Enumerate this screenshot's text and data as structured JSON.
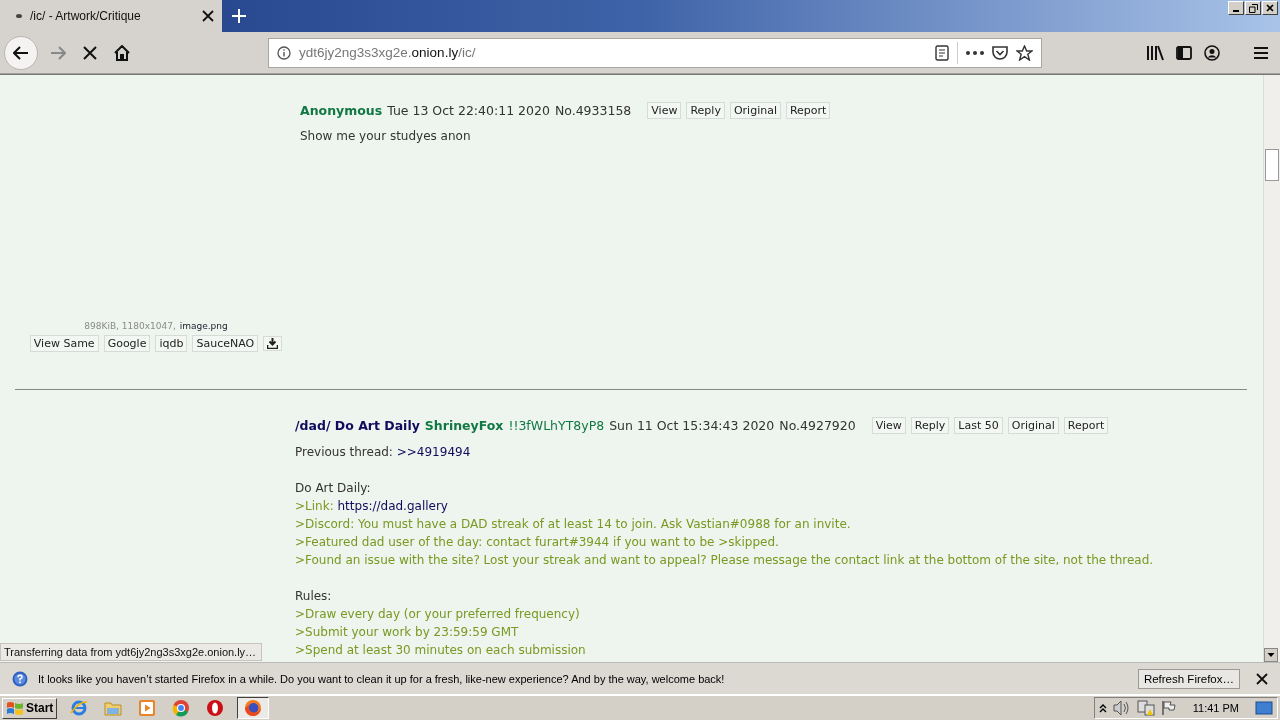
{
  "browser": {
    "tab": {
      "title": "/ic/ - Artwork/Critique",
      "selected": true
    },
    "url": [
      {
        "text": "ydt6jy2ng3s3xg2e.",
        "highlighted": false
      },
      {
        "text": "onion.ly",
        "highlighted": true
      },
      {
        "text": "/ic/",
        "highlighted": false
      }
    ],
    "status": "Transferring data from ydt6jy2ng3s3xg2e.onion.ly…"
  },
  "posts": [
    {
      "name": "Anonymous",
      "date": "Tue 13 Oct 22:40:11 2020",
      "number": "No.4933158",
      "buttons": [
        "View",
        "Reply",
        "Original",
        "Report"
      ],
      "body": [
        {
          "kind": "text",
          "text": "Show me your studyes anon"
        }
      ],
      "file": {
        "info": "898KiB, 1180x1047,",
        "filename": "image.png",
        "buttons": [
          "View Same",
          "Google",
          "iqdb",
          "SauceNAO"
        ]
      }
    },
    {
      "subject": "/dad/ Do Art Daily",
      "name": "ShrineyFox",
      "tripcode": "!!3fWLhYT8yP8",
      "date": "Sun 11 Oct 15:34:43 2020",
      "number": "No.4927920",
      "buttons": [
        "View",
        "Reply",
        "Last 50",
        "Original",
        "Report"
      ],
      "body": [
        {
          "kind": "text",
          "text": "Previous thread:",
          "link": ">>4919494"
        },
        {
          "kind": "gap"
        },
        {
          "kind": "text",
          "text": "Do Art Daily:"
        },
        {
          "kind": "quote",
          "text": ">Link:",
          "link": "https://dad.gallery"
        },
        {
          "kind": "quote",
          "text": ">Discord: You must have a DAD streak of at least 14 to join. Ask Vastian#0988 for an invite."
        },
        {
          "kind": "quote",
          "text": ">Featured dad user of the day: contact furart#3944 if you want to be >skipped."
        },
        {
          "kind": "quote",
          "text": ">Found an issue with the site? Lost your streak and want to appeal? Please message the contact link at the bottom of the site, not the thread."
        },
        {
          "kind": "gap"
        },
        {
          "kind": "text",
          "text": "Rules:"
        },
        {
          "kind": "quote",
          "text": ">Draw every day (or your preferred frequency)"
        },
        {
          "kind": "quote",
          "text": ">Submit your work by 23:59:59 GMT"
        },
        {
          "kind": "quote",
          "text": ">Spend at least 30 minutes on each submission"
        }
      ]
    }
  ],
  "notification": {
    "text": "It looks like you haven’t started Firefox in a while. Do you want to clean it up for a fresh, like-new experience? And by the way, welcome back!",
    "button": "Refresh Firefox…"
  },
  "taskbar": {
    "start": "Start",
    "clock": "11:41 PM"
  }
}
